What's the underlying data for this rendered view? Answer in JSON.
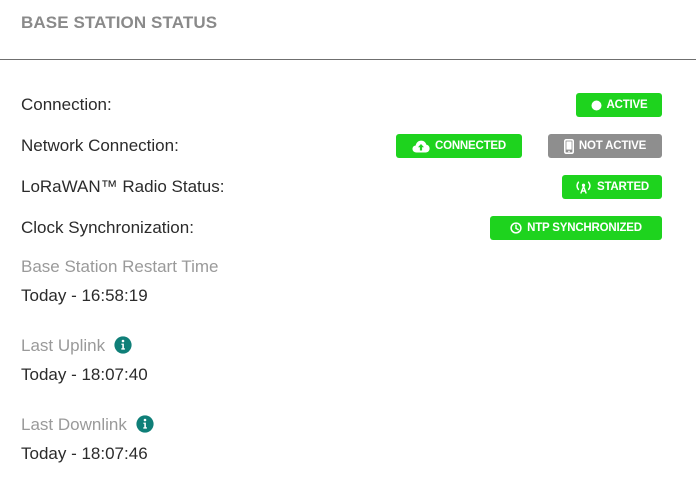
{
  "panel": {
    "title": "BASE STATION STATUS"
  },
  "status": {
    "connection_label": "Connection:",
    "connection_badge": "ACTIVE",
    "network_label": "Network Connection:",
    "network_badge_1": "CONNECTED",
    "network_badge_2": "NOT ACTIVE",
    "lorawan_label": "LoRaWAN™ Radio Status:",
    "lorawan_badge": "STARTED",
    "clock_label": "Clock Synchronization:",
    "clock_badge": "NTP SYNCHRONIZED"
  },
  "info": {
    "restart_label": "Base Station Restart Time",
    "restart_value": "Today - 16:58:19",
    "uplink_label": "Last Uplink",
    "uplink_value": "Today - 18:07:40",
    "downlink_label": "Last Downlink",
    "downlink_value": "Today - 18:07:46"
  },
  "icons": {
    "active": "circle-icon",
    "connected": "cloud-upload-icon",
    "not_active": "mobile-phone-icon",
    "started": "radio-tower-icon",
    "ntp": "clock-icon",
    "info": "info-icon"
  },
  "colors": {
    "badge_green": "#1ed31e",
    "badge_grey": "#8e8e8e",
    "info_icon": "#0f7f78",
    "title_grey": "#8a8a8a"
  }
}
